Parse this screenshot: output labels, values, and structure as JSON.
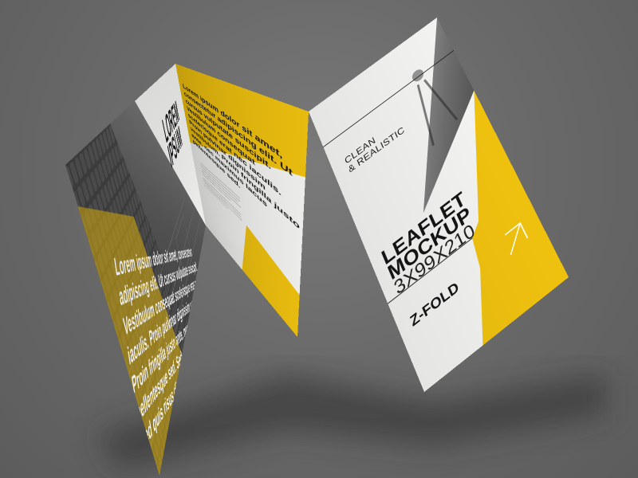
{
  "leaflet": {
    "cover_title_line1": "LOREM",
    "cover_title_line2": "IPSUM",
    "cover_body": "Lorem ipsum dolor sit amet, consectetur adipiscing elit. Ut cursus vulputate suscipit. Vestibulum consequat scelerisque erat nec iaculis. Proin pulvinar dignissim vestibulum. Proin fringilla justo ante, nec maximus lacus pellentesque sed. Sed eu consequat magna. Sed quis risus diam.",
    "inner_body": "Lorem ipsum dolor sit amet, consectetur adipiscing elit. Ut cursus vulputate suscipit. Vestibulum consequat scelerisque erat nec iaculis. Proin pulvinar dignissim vestibulum. Proin fringilla justo ante, nec maximus lacus pellentesque sed.",
    "tagline_line1": "CLEAN",
    "tagline_line2": "& REALISTIC",
    "headline_line1": "LEAFLET",
    "headline_line2": "MOCKUP",
    "dimensions": "3X99X210",
    "fold_type": "Z-FOLD"
  },
  "colors": {
    "background": "#6a6a6a",
    "accent_yellow": "#efc10f",
    "paper_white": "#f4f4f2",
    "ink": "#151515"
  },
  "icons": [
    "arrow-up-right-icon"
  ]
}
